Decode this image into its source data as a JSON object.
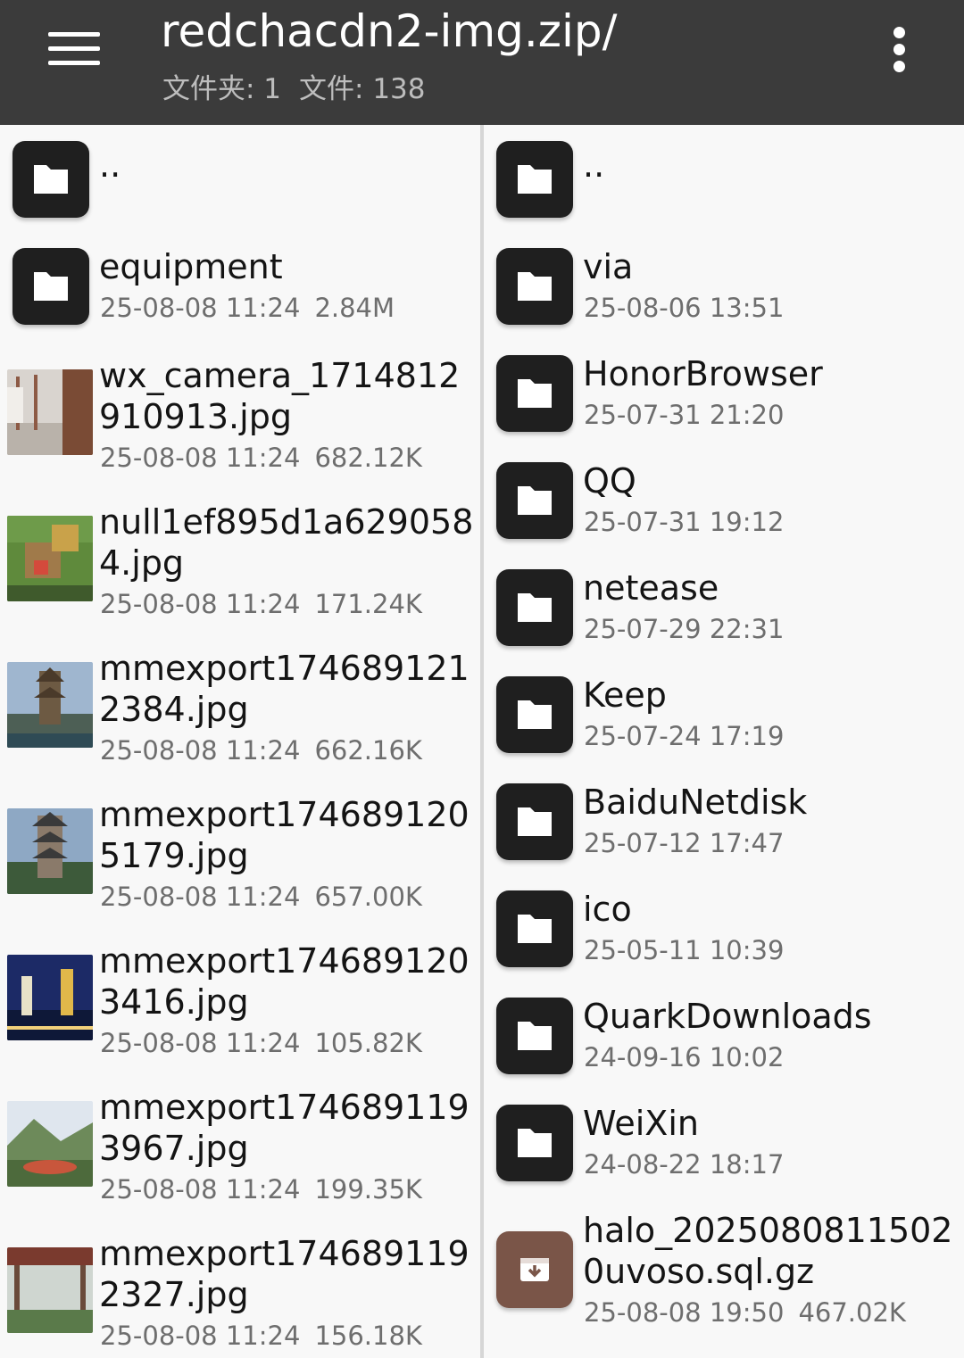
{
  "header": {
    "title": "redchacdn2-img.zip/",
    "folders_label": "文件夹: 1",
    "files_label": "文件: 138"
  },
  "left_pane": {
    "parent": {
      "name": ".."
    },
    "items": [
      {
        "kind": "folder",
        "name": "equipment",
        "date": "25-08-08 11:24",
        "size": "2.84M"
      },
      {
        "kind": "image",
        "name1": "wx_camera_1714812",
        "name2": "910913.jpg",
        "date": "25-08-08 11:24",
        "size": "682.12K"
      },
      {
        "kind": "image",
        "name1": "null1ef895d1a629058",
        "name2": "4.jpg",
        "date": "25-08-08 11:24",
        "size": "171.24K"
      },
      {
        "kind": "image",
        "name1": "mmexport174689121",
        "name2": "2384.jpg",
        "date": "25-08-08 11:24",
        "size": "662.16K"
      },
      {
        "kind": "image",
        "name1": "mmexport174689120",
        "name2": "5179.jpg",
        "date": "25-08-08 11:24",
        "size": "657.00K"
      },
      {
        "kind": "image",
        "name1": "mmexport174689120",
        "name2": "3416.jpg",
        "date": "25-08-08 11:24",
        "size": "105.82K"
      },
      {
        "kind": "image",
        "name1": "mmexport174689119",
        "name2": "3967.jpg",
        "date": "25-08-08 11:24",
        "size": "199.35K"
      },
      {
        "kind": "image",
        "name1": "mmexport174689119",
        "name2": "2327.jpg",
        "date": "25-08-08 11:24",
        "size": "156.18K"
      }
    ]
  },
  "right_pane": {
    "parent": {
      "name": ".."
    },
    "items": [
      {
        "kind": "folder",
        "name": "via",
        "date": "25-08-06 13:51"
      },
      {
        "kind": "folder",
        "name": "HonorBrowser",
        "date": "25-07-31 21:20"
      },
      {
        "kind": "folder",
        "name": "QQ",
        "date": "25-07-31 19:12"
      },
      {
        "kind": "folder",
        "name": "netease",
        "date": "25-07-29 22:31"
      },
      {
        "kind": "folder",
        "name": "Keep",
        "date": "25-07-24 17:19"
      },
      {
        "kind": "folder",
        "name": "BaiduNetdisk",
        "date": "25-07-12 17:47"
      },
      {
        "kind": "folder",
        "name": "ico",
        "date": "25-05-11 10:39"
      },
      {
        "kind": "folder",
        "name": "QuarkDownloads",
        "date": "24-09-16 10:02"
      },
      {
        "kind": "folder",
        "name": "WeiXin",
        "date": "24-08-22 18:17"
      },
      {
        "kind": "archive",
        "name1": "halo_2025080811502",
        "name2": "0uvoso.sql.gz",
        "date": "25-08-08 19:50",
        "size": "467.02K"
      }
    ]
  },
  "colors": {
    "toolbar": "#3b3b3b",
    "folder_icon": "#1f1f1f",
    "archive_icon": "#7a5548"
  }
}
